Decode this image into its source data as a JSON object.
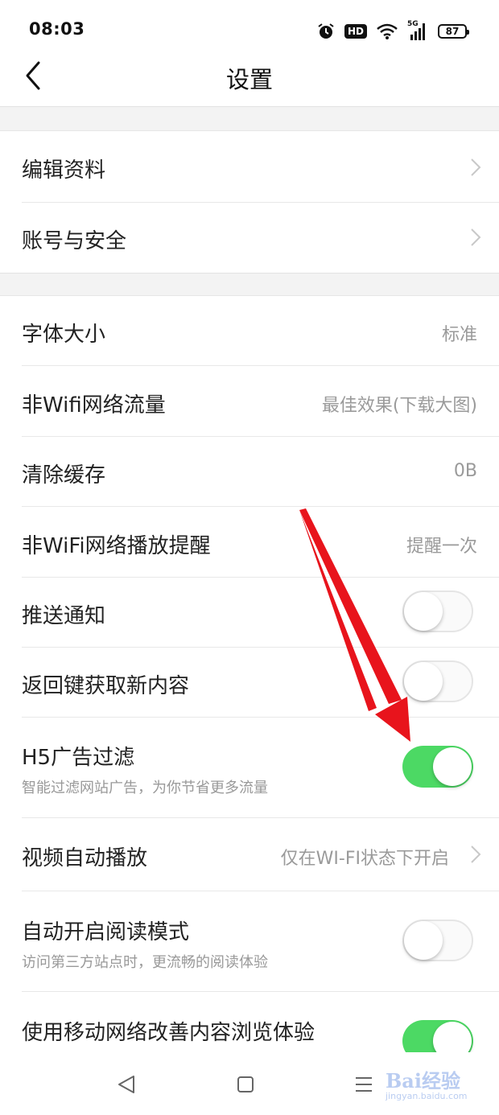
{
  "status_bar": {
    "time": "08:03",
    "icons": [
      "alarm-icon",
      "hd-icon",
      "wifi-icon",
      "5g-signal-icon",
      "battery-icon"
    ],
    "hd_label": "HD",
    "signal_label": "5G",
    "battery": "87"
  },
  "header": {
    "title": "设置",
    "back_icon": "chevron-left-icon"
  },
  "section1": {
    "items": [
      {
        "label": "编辑资料"
      },
      {
        "label": "账号与安全"
      }
    ]
  },
  "section2": {
    "items": [
      {
        "label": "字体大小",
        "value": "标准"
      },
      {
        "label": "非Wifi网络流量",
        "value": "最佳效果(下载大图)"
      },
      {
        "label": "清除缓存",
        "value": "0B"
      },
      {
        "label": "非WiFi网络播放提醒",
        "value": "提醒一次"
      },
      {
        "label": "推送通知",
        "toggle": "off"
      },
      {
        "label": "返回键获取新内容",
        "toggle": "off"
      },
      {
        "label": "H5广告过滤",
        "sub": "智能过滤网站广告，为你节省更多流量",
        "toggle": "on"
      },
      {
        "label": "视频自动播放",
        "value": "仅在WI-FI状态下开启"
      },
      {
        "label": "自动开启阅读模式",
        "sub": "访问第三方站点时，更流畅的阅读体验",
        "toggle": "off"
      },
      {
        "label": "使用移动网络改善内容浏览体验",
        "toggle": "on"
      }
    ]
  },
  "bottom_nav": {
    "icons": [
      "back-triangle-icon",
      "home-square-icon",
      "menu-lines-icon"
    ]
  },
  "watermark": {
    "brand": "Bai经验",
    "url": "jingyan.baidu.com"
  },
  "colors": {
    "toggle_on": "#4cd964",
    "arrow": "#e8141c",
    "section_gap": "#f3f3f3"
  }
}
